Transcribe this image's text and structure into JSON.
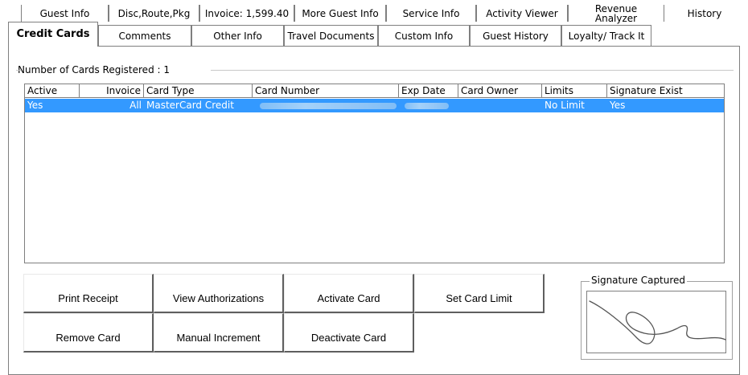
{
  "tabs_row1": [
    {
      "label": "Guest Info"
    },
    {
      "label": "Disc,Route,Pkg"
    },
    {
      "label": "Invoice: 1,599.40"
    },
    {
      "label": "More Guest Info"
    },
    {
      "label": "Service Info"
    },
    {
      "label": "Activity Viewer"
    },
    {
      "label": "Revenue Analyzer"
    },
    {
      "label": "History"
    }
  ],
  "tabs_row2": [
    {
      "label": "Credit Cards",
      "active": true
    },
    {
      "label": "Comments"
    },
    {
      "label": "Other Info"
    },
    {
      "label": "Travel Documents"
    },
    {
      "label": "Custom Info"
    },
    {
      "label": "Guest History"
    },
    {
      "label": "Loyalty/ Track It"
    }
  ],
  "cards": {
    "group_label": "Number of Cards Registered : 1",
    "columns": [
      "Active",
      "Invoice",
      "Card Type",
      "Card Number",
      "Exp Date",
      "Card Owner",
      "Limits",
      "Signature Exist"
    ],
    "rows": [
      {
        "active": "Yes",
        "invoice": "All",
        "card_type": "MasterCard Credit",
        "card_number": "",
        "exp_date": "",
        "card_owner": "",
        "limits": "No Limit",
        "signature_exist": "Yes"
      }
    ]
  },
  "buttons": {
    "print_receipt": "Print Receipt",
    "view_authorizations": "View Authorizations",
    "activate_card": "Activate Card",
    "set_card_limit": "Set Card Limit",
    "remove_card": "Remove Card",
    "manual_increment": "Manual Increment",
    "deactivate_card": "Deactivate Card"
  },
  "signature": {
    "label": "Signature Captured"
  },
  "colors": {
    "selection": "#3399ff",
    "border": "#7f7f7f"
  }
}
